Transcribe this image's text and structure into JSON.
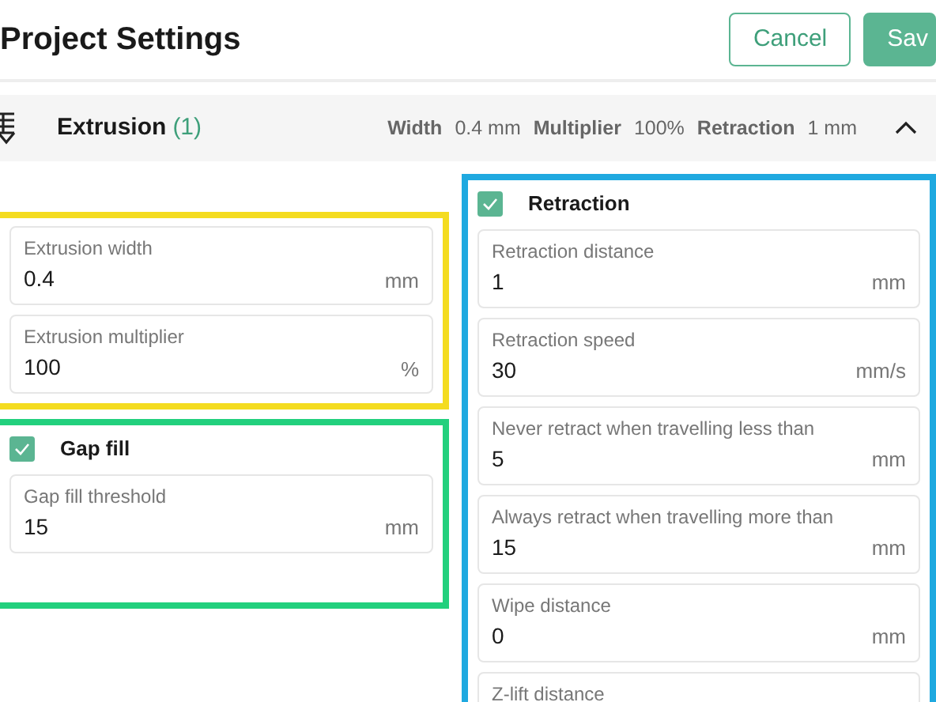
{
  "header": {
    "title": "Project Settings",
    "buttons": [
      {
        "label": "Cancel",
        "kind": "outline"
      },
      {
        "label": "Sav",
        "kind": "primary"
      }
    ]
  },
  "section": {
    "title": "Extrusion",
    "count": "(1)",
    "expanded": true,
    "summary": [
      {
        "label": "Width",
        "value": "0.4 mm"
      },
      {
        "label": "Multiplier",
        "value": "100%"
      },
      {
        "label": "Retraction",
        "value": "1 mm"
      }
    ]
  },
  "columns": [
    [
      {
        "color": "#f4dc1f",
        "fields": [
          {
            "label": "Extrusion width",
            "value": "0.4",
            "unit": "mm"
          },
          {
            "label": "Extrusion multiplier",
            "value": "100",
            "unit": "%"
          }
        ]
      },
      {
        "color": "#22d07d",
        "title": "Gap fill",
        "checked": true,
        "fields": [
          {
            "label": "Gap fill threshold",
            "value": "15",
            "unit": "mm"
          }
        ]
      }
    ],
    [
      {
        "color": "#1fa9e0",
        "title": "Retraction",
        "checked": true,
        "fields": [
          {
            "label": "Retraction distance",
            "value": "1",
            "unit": "mm"
          },
          {
            "label": "Retraction speed",
            "value": "30",
            "unit": "mm/s"
          },
          {
            "label": "Never retract when travelling less than",
            "value": "5",
            "unit": "mm"
          },
          {
            "label": "Always retract when travelling more than",
            "value": "15",
            "unit": "mm"
          },
          {
            "label": "Wipe distance",
            "value": "0",
            "unit": "mm"
          },
          {
            "label": "Z-lift distance"
          }
        ]
      }
    ]
  ]
}
